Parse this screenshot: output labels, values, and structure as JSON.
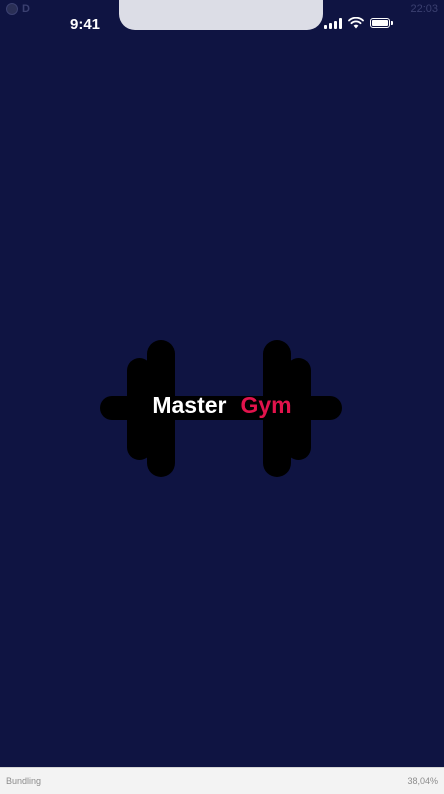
{
  "android_status": {
    "left_letter": "D",
    "time": "22:03"
  },
  "ios_status": {
    "time": "9:41",
    "icons": [
      "cellular-signal-icon",
      "wifi-icon",
      "battery-icon"
    ]
  },
  "splash": {
    "word1": "Master",
    "word2": "Gym",
    "icon": "dumbbell-icon",
    "background_color": "#0f1442",
    "accent_color": "#e2134c",
    "text_color": "#ffffff"
  },
  "bundling": {
    "label": "Bundling",
    "progress": "38,04%",
    "progress_value": 0.3804
  }
}
